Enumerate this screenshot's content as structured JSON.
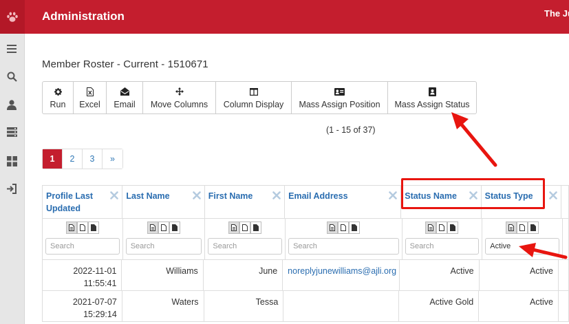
{
  "app": {
    "title": "Administration",
    "org": "The Ju"
  },
  "sidebar": {
    "items": [
      {
        "icon": "menu-icon"
      },
      {
        "icon": "search-icon"
      },
      {
        "icon": "user-icon"
      },
      {
        "icon": "storage-icon"
      },
      {
        "icon": "dashboard-icon"
      },
      {
        "icon": "sign-in-icon"
      }
    ]
  },
  "page": {
    "title": "Member Roster - Current - 1510671"
  },
  "toolbar": {
    "run": "Run",
    "excel": "Excel",
    "email": "Email",
    "move_columns": "Move Columns",
    "column_display": "Column Display",
    "mass_assign_position": "Mass Assign Position",
    "mass_assign_status": "Mass Assign Status"
  },
  "records": {
    "count_text": "(1 - 15 of 37)"
  },
  "pagination": {
    "pages": [
      "1",
      "2",
      "3"
    ],
    "next": "»",
    "current": "1"
  },
  "table": {
    "columns": [
      {
        "label": "Profile Last Updated",
        "placeholder": "Search",
        "filter": ""
      },
      {
        "label": "Last Name",
        "placeholder": "Search",
        "filter": ""
      },
      {
        "label": "First Name",
        "placeholder": "Search",
        "filter": ""
      },
      {
        "label": "Email Address",
        "placeholder": "Search",
        "filter": ""
      },
      {
        "label": "Status Name",
        "placeholder": "Search",
        "filter": ""
      },
      {
        "label": "Status Type",
        "placeholder": "Search",
        "filter": "Active"
      }
    ],
    "rows": [
      {
        "updated_date": "2022-11-01",
        "updated_time": "11:55:41",
        "last": "Williams",
        "first": "June",
        "email": "noreplyjunewilliams@ajli.org",
        "status_name": "Active",
        "status_type": "Active"
      },
      {
        "updated_date": "2021-07-07",
        "updated_time": "15:29:14",
        "last": "Waters",
        "first": "Tessa",
        "email": "",
        "status_name": "Active Gold",
        "status_type": "Active"
      }
    ]
  },
  "colors": {
    "brand": "#c41e2e",
    "link": "#2a6db0",
    "annotation": "#e8150f"
  }
}
